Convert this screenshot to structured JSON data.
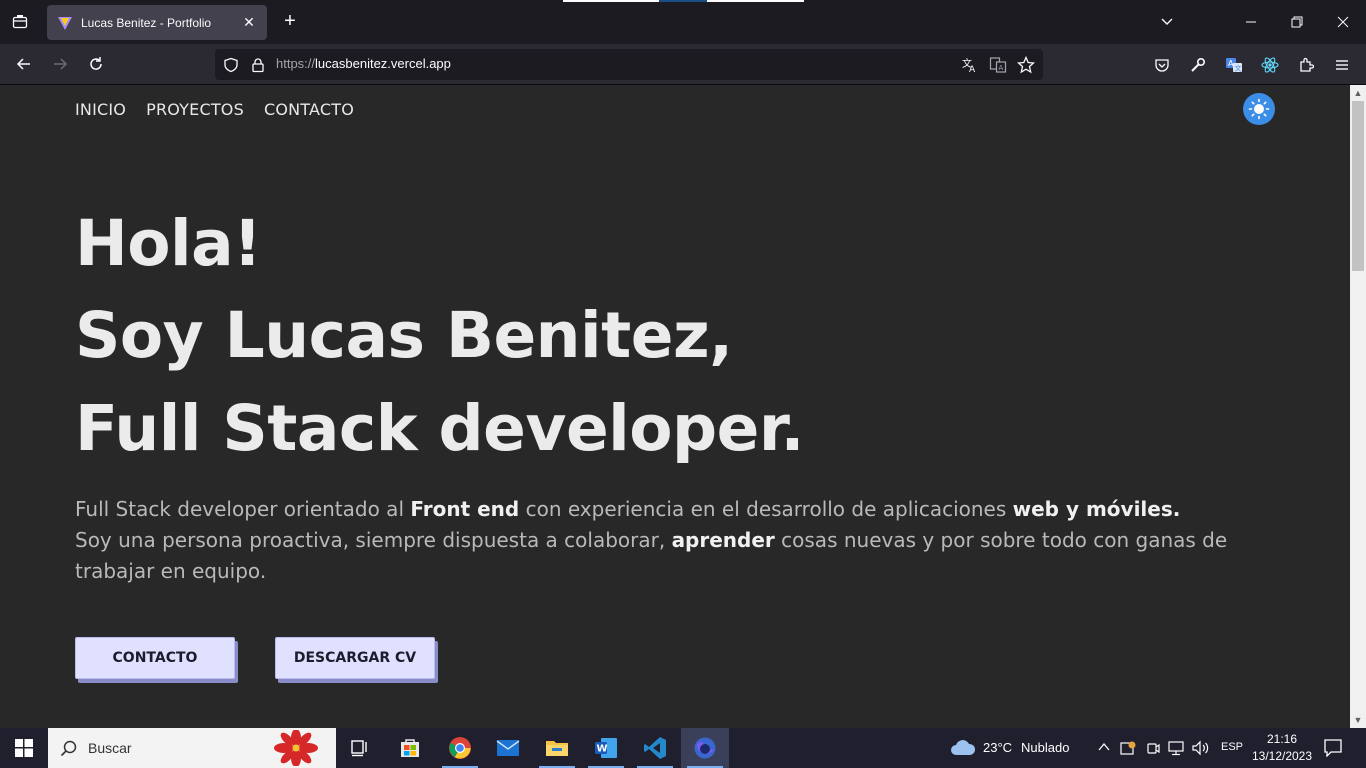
{
  "browser": {
    "tab_title": "Lucas Benitez - Portfolio",
    "url_protocol": "https://",
    "url_host": "lucasbenitez.vercel.app"
  },
  "site": {
    "nav": [
      "INICIO",
      "PROYECTOS",
      "CONTACTO"
    ],
    "hero": {
      "line1": "Hola!",
      "line2": "Soy Lucas Benitez,",
      "line3": "Full Stack developer."
    },
    "bio": {
      "p1_a": "Full Stack developer orientado al ",
      "p1_b": "Front end",
      "p1_c": " con experiencia en el desarrollo de aplicaciones ",
      "p1_d": "web y móviles.",
      "p2_a": "Soy una persona proactiva, siempre dispuesta a colaborar, ",
      "p2_b": "aprender",
      "p2_c": " cosas nuevas y por sobre todo con ganas de trabajar en equipo."
    },
    "buttons": {
      "contact": "CONTACTO",
      "download_cv": "DESCARGAR CV"
    }
  },
  "taskbar": {
    "search_placeholder": "Buscar",
    "weather_temp": "23°C",
    "weather_desc": "Nublado",
    "language": "ESP",
    "time": "21:16",
    "date": "13/12/2023"
  },
  "colors": {
    "page_bg": "#282828",
    "button_bg": "#dfe1ff",
    "toggle_bg": "#3b8de6"
  }
}
